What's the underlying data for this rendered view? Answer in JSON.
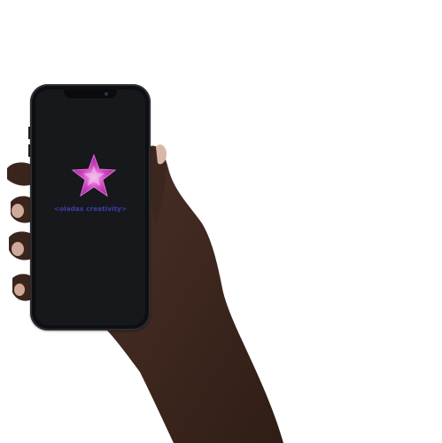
{
  "app": {
    "brand_text": "<oladax creativity>",
    "logo_icon": "star-icon",
    "brand_color": "#3d3db0",
    "logo_color": "#c637b8",
    "screen_color": "#17181c",
    "background_color": "#ffffff"
  }
}
